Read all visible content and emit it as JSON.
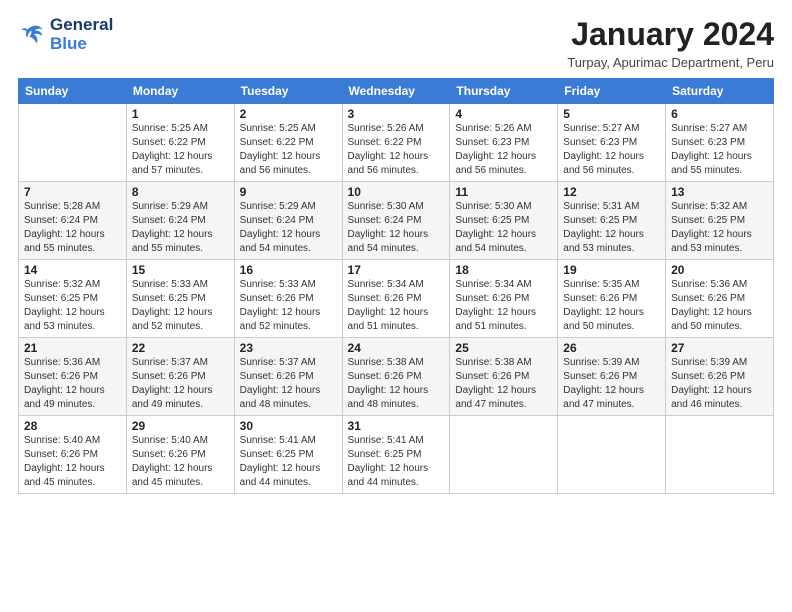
{
  "logo": {
    "line1": "General",
    "line2": "Blue"
  },
  "title": "January 2024",
  "subtitle": "Turpay, Apurimac Department, Peru",
  "header_days": [
    "Sunday",
    "Monday",
    "Tuesday",
    "Wednesday",
    "Thursday",
    "Friday",
    "Saturday"
  ],
  "weeks": [
    [
      {
        "day": "",
        "info": ""
      },
      {
        "day": "1",
        "info": "Sunrise: 5:25 AM\nSunset: 6:22 PM\nDaylight: 12 hours\nand 57 minutes."
      },
      {
        "day": "2",
        "info": "Sunrise: 5:25 AM\nSunset: 6:22 PM\nDaylight: 12 hours\nand 56 minutes."
      },
      {
        "day": "3",
        "info": "Sunrise: 5:26 AM\nSunset: 6:22 PM\nDaylight: 12 hours\nand 56 minutes."
      },
      {
        "day": "4",
        "info": "Sunrise: 5:26 AM\nSunset: 6:23 PM\nDaylight: 12 hours\nand 56 minutes."
      },
      {
        "day": "5",
        "info": "Sunrise: 5:27 AM\nSunset: 6:23 PM\nDaylight: 12 hours\nand 56 minutes."
      },
      {
        "day": "6",
        "info": "Sunrise: 5:27 AM\nSunset: 6:23 PM\nDaylight: 12 hours\nand 55 minutes."
      }
    ],
    [
      {
        "day": "7",
        "info": "Sunrise: 5:28 AM\nSunset: 6:24 PM\nDaylight: 12 hours\nand 55 minutes."
      },
      {
        "day": "8",
        "info": "Sunrise: 5:29 AM\nSunset: 6:24 PM\nDaylight: 12 hours\nand 55 minutes."
      },
      {
        "day": "9",
        "info": "Sunrise: 5:29 AM\nSunset: 6:24 PM\nDaylight: 12 hours\nand 54 minutes."
      },
      {
        "day": "10",
        "info": "Sunrise: 5:30 AM\nSunset: 6:24 PM\nDaylight: 12 hours\nand 54 minutes."
      },
      {
        "day": "11",
        "info": "Sunrise: 5:30 AM\nSunset: 6:25 PM\nDaylight: 12 hours\nand 54 minutes."
      },
      {
        "day": "12",
        "info": "Sunrise: 5:31 AM\nSunset: 6:25 PM\nDaylight: 12 hours\nand 53 minutes."
      },
      {
        "day": "13",
        "info": "Sunrise: 5:32 AM\nSunset: 6:25 PM\nDaylight: 12 hours\nand 53 minutes."
      }
    ],
    [
      {
        "day": "14",
        "info": "Sunrise: 5:32 AM\nSunset: 6:25 PM\nDaylight: 12 hours\nand 53 minutes."
      },
      {
        "day": "15",
        "info": "Sunrise: 5:33 AM\nSunset: 6:25 PM\nDaylight: 12 hours\nand 52 minutes."
      },
      {
        "day": "16",
        "info": "Sunrise: 5:33 AM\nSunset: 6:26 PM\nDaylight: 12 hours\nand 52 minutes."
      },
      {
        "day": "17",
        "info": "Sunrise: 5:34 AM\nSunset: 6:26 PM\nDaylight: 12 hours\nand 51 minutes."
      },
      {
        "day": "18",
        "info": "Sunrise: 5:34 AM\nSunset: 6:26 PM\nDaylight: 12 hours\nand 51 minutes."
      },
      {
        "day": "19",
        "info": "Sunrise: 5:35 AM\nSunset: 6:26 PM\nDaylight: 12 hours\nand 50 minutes."
      },
      {
        "day": "20",
        "info": "Sunrise: 5:36 AM\nSunset: 6:26 PM\nDaylight: 12 hours\nand 50 minutes."
      }
    ],
    [
      {
        "day": "21",
        "info": "Sunrise: 5:36 AM\nSunset: 6:26 PM\nDaylight: 12 hours\nand 49 minutes."
      },
      {
        "day": "22",
        "info": "Sunrise: 5:37 AM\nSunset: 6:26 PM\nDaylight: 12 hours\nand 49 minutes."
      },
      {
        "day": "23",
        "info": "Sunrise: 5:37 AM\nSunset: 6:26 PM\nDaylight: 12 hours\nand 48 minutes."
      },
      {
        "day": "24",
        "info": "Sunrise: 5:38 AM\nSunset: 6:26 PM\nDaylight: 12 hours\nand 48 minutes."
      },
      {
        "day": "25",
        "info": "Sunrise: 5:38 AM\nSunset: 6:26 PM\nDaylight: 12 hours\nand 47 minutes."
      },
      {
        "day": "26",
        "info": "Sunrise: 5:39 AM\nSunset: 6:26 PM\nDaylight: 12 hours\nand 47 minutes."
      },
      {
        "day": "27",
        "info": "Sunrise: 5:39 AM\nSunset: 6:26 PM\nDaylight: 12 hours\nand 46 minutes."
      }
    ],
    [
      {
        "day": "28",
        "info": "Sunrise: 5:40 AM\nSunset: 6:26 PM\nDaylight: 12 hours\nand 45 minutes."
      },
      {
        "day": "29",
        "info": "Sunrise: 5:40 AM\nSunset: 6:26 PM\nDaylight: 12 hours\nand 45 minutes."
      },
      {
        "day": "30",
        "info": "Sunrise: 5:41 AM\nSunset: 6:25 PM\nDaylight: 12 hours\nand 44 minutes."
      },
      {
        "day": "31",
        "info": "Sunrise: 5:41 AM\nSunset: 6:25 PM\nDaylight: 12 hours\nand 44 minutes."
      },
      {
        "day": "",
        "info": ""
      },
      {
        "day": "",
        "info": ""
      },
      {
        "day": "",
        "info": ""
      }
    ]
  ]
}
